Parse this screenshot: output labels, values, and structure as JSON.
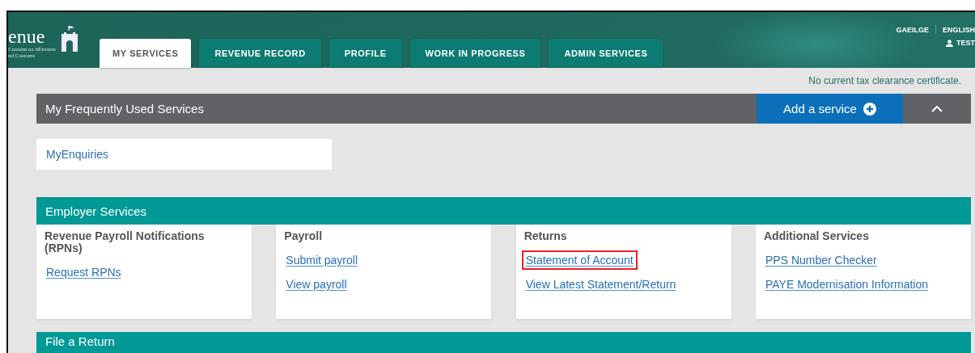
{
  "header": {
    "logo_title": "enue",
    "logo_lines": [
      "Custaim na hÉireann",
      "nd Customs"
    ],
    "tabs": [
      {
        "label": "MY SERVICES",
        "selected": true
      },
      {
        "label": "REVENUE RECORD",
        "selected": false
      },
      {
        "label": "PROFILE",
        "selected": false
      },
      {
        "label": "WORK IN PROGRESS",
        "selected": false
      },
      {
        "label": "ADMIN SERVICES",
        "selected": false
      }
    ],
    "languages": [
      "GAEILGE",
      "ENGLISH"
    ],
    "user": "TEST"
  },
  "notice": "No current tax clearance certificate.",
  "frequent": {
    "title": "My Frequently Used Services",
    "add_button": "Add a service",
    "expanded": true,
    "items": [
      "MyEnquiries"
    ]
  },
  "employer": {
    "title": "Employer Services",
    "cards": [
      {
        "title": "Revenue Payroll Notifications (RPNs)",
        "links": [
          {
            "label": "Request RPNs",
            "highlighted": false
          }
        ]
      },
      {
        "title": "Payroll",
        "links": [
          {
            "label": "Submit payroll",
            "highlighted": false
          },
          {
            "label": "View payroll",
            "highlighted": false
          }
        ]
      },
      {
        "title": "Returns",
        "links": [
          {
            "label": "Statement of Account",
            "highlighted": true
          },
          {
            "label": "View Latest Statement/Return",
            "highlighted": false
          }
        ]
      },
      {
        "title": "Additional Services",
        "links": [
          {
            "label": "PPS Number Checker",
            "highlighted": false
          },
          {
            "label": "PAYE Modernisation Information",
            "highlighted": false
          }
        ]
      }
    ]
  },
  "file_return": {
    "title": "File a Return"
  }
}
